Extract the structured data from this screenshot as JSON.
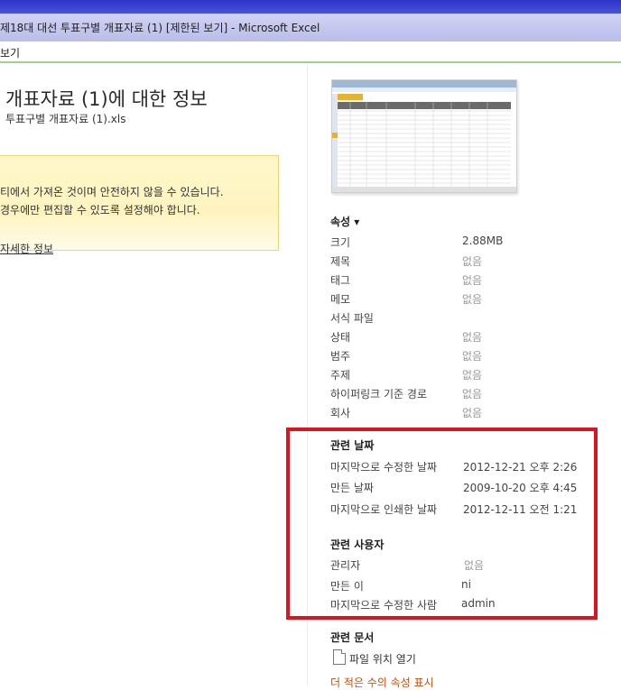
{
  "window": {
    "title": "제18대 대선 투표구별 개표자료 (1)  [제한된 보기]  -  Microsoft Excel"
  },
  "menu": {
    "view_label": "보기"
  },
  "info": {
    "title": "개표자료 (1)에 대한 정보",
    "filename": "투표구별 개표자료 (1).xls",
    "warning_line1": "티에서 가져온 것이며 안전하지 않을 수 있습니다.",
    "warning_line2": " 경우에만 편집할 수 있도록 설정해야 합니다.",
    "more_link": "자세한 정보"
  },
  "properties": {
    "header": "속성 ▾",
    "items": [
      {
        "label": "크기",
        "value": "2.88MB"
      },
      {
        "label": "제목",
        "value": "없음"
      },
      {
        "label": "태그",
        "value": "없음"
      },
      {
        "label": "메모",
        "value": "없음"
      },
      {
        "label": "서식 파일",
        "value": ""
      },
      {
        "label": "상태",
        "value": "없음"
      },
      {
        "label": "범주",
        "value": "없음"
      },
      {
        "label": "주제",
        "value": "없음"
      },
      {
        "label": "하이퍼링크 기준 경로",
        "value": "없음"
      },
      {
        "label": "회사",
        "value": "없음"
      }
    ]
  },
  "dates": {
    "header": "관련 날짜",
    "items": [
      {
        "label": "마지막으로 수정한 날짜",
        "value": "2012-12-21 오후 2:26"
      },
      {
        "label": "만든 날짜",
        "value": "2009-10-20 오후 4:45"
      },
      {
        "label": "마지막으로 인쇄한 날짜",
        "value": "2012-12-11 오전 1:21"
      }
    ]
  },
  "people": {
    "header": "관련 사용자",
    "items": [
      {
        "label": "관리자",
        "value": "없음"
      },
      {
        "label": "만든 이",
        "value": "ni"
      },
      {
        "label": "마지막으로 수정한 사람",
        "value": "admin"
      }
    ]
  },
  "docs": {
    "header": "관련 문서",
    "open_location": "파일 위치 열기",
    "show_all": "더 적은 수의 속성 표시"
  },
  "colors": {
    "highlight_border": "#d9161e",
    "link_orange": "#c6500e",
    "warning_bg": "#fff6c8"
  }
}
